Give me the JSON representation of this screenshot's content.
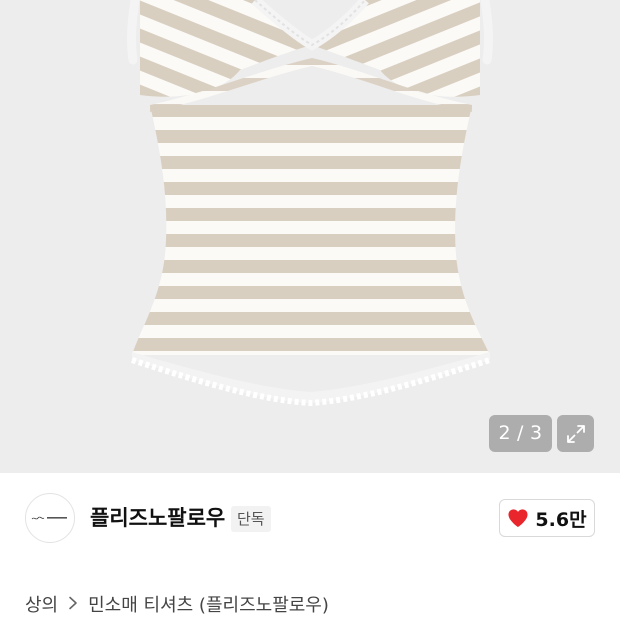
{
  "gallery": {
    "current_page": "2",
    "separator": "/",
    "total_pages": "3",
    "expand_icon": "expand-icon"
  },
  "brand": {
    "name": "플리즈노팔로우",
    "badge": "단독",
    "logo_icon": "brand-logo"
  },
  "like": {
    "icon": "heart-icon",
    "count": "5.6만",
    "color": "#e8262c"
  },
  "breadcrumb": {
    "category": "상의",
    "separator_icon": "chevron-right-icon",
    "subcategory": "민소매 티셔츠 (플리즈노팔로우)"
  },
  "colors": {
    "stripe_beige": "#d9cfc0",
    "stripe_white": "#fbfaf7",
    "gallery_bg": "#ededed"
  }
}
